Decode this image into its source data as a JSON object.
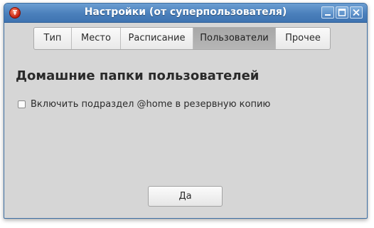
{
  "window": {
    "title": "Настройки (от суперпользователя)"
  },
  "titlebar_buttons": {
    "minimize_icon": "minimize-icon",
    "maximize_icon": "maximize-icon",
    "close_icon": "close-icon"
  },
  "tabs": [
    {
      "label": "Тип"
    },
    {
      "label": "Место"
    },
    {
      "label": "Расписание"
    },
    {
      "label": "Пользователи",
      "active": true
    },
    {
      "label": "Прочее"
    }
  ],
  "main": {
    "heading": "Домашние папки пользователей",
    "checkbox_label": "Включить подраздел @home в резервную копию",
    "checkbox_checked": false,
    "ok_label": "Да"
  },
  "colors": {
    "titlebar": "#4a7fbb",
    "window_bg": "#d6d6d6",
    "active_tab": "#b0b0b0"
  }
}
